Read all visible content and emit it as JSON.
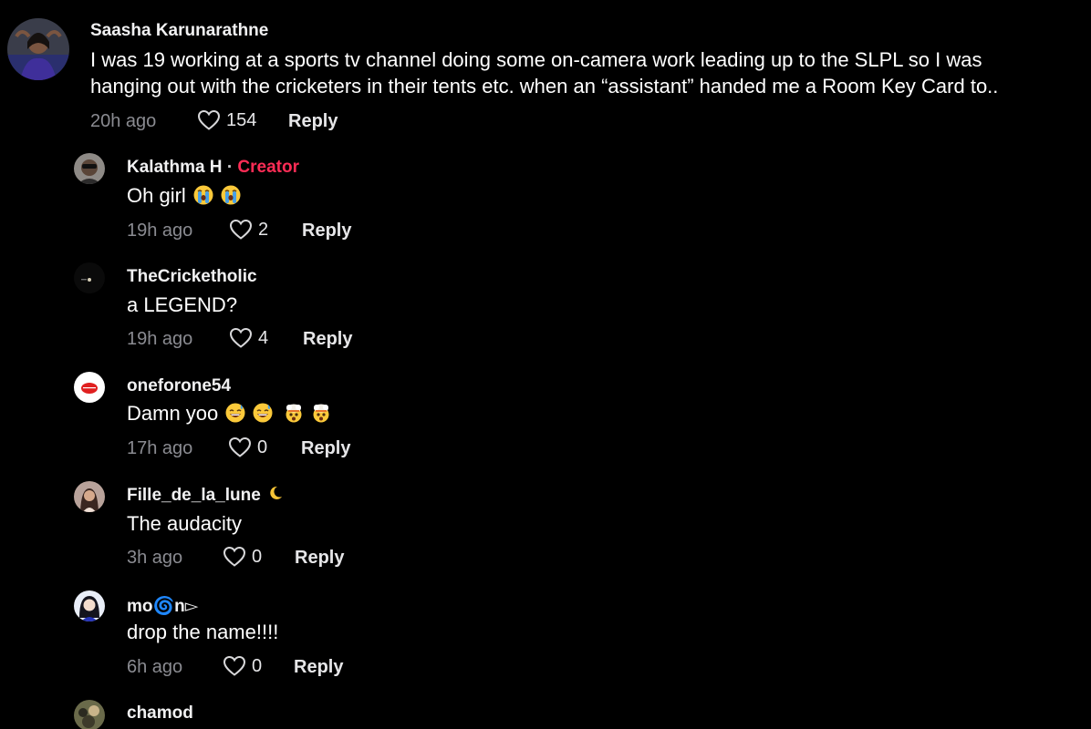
{
  "comments": [
    {
      "username": "Saasha Karunarathne",
      "text_line1": "I was 19 working at a sports tv channel doing some on-camera work leading up to the SLPL so I was",
      "text_line2": "hanging out with the cricketers in their tents etc. when an “assistant” handed me a Room Key Card to..",
      "time": "20h ago",
      "likes": "154",
      "reply_label": "Reply"
    },
    {
      "username": "Kalathma H",
      "separator": "·",
      "badge": "Creator",
      "text": "Oh girl",
      "emojis": [
        "loudly-crying-face",
        "loudly-crying-face"
      ],
      "time": "19h ago",
      "likes": "2",
      "reply_label": "Reply"
    },
    {
      "username": "TheCricketholic",
      "text": "a LEGEND?",
      "time": "19h ago",
      "likes": "4",
      "reply_label": "Reply"
    },
    {
      "username": "oneforone54",
      "text": "Damn yoo",
      "emojis": [
        "grinning-sweat-face",
        "grinning-sweat-face",
        "exploding-head",
        "exploding-head"
      ],
      "time": "17h ago",
      "likes": "0",
      "reply_label": "Reply"
    },
    {
      "username": "Fille_de_la_lune",
      "name_emoji": "crescent-moon",
      "text": "The audacity",
      "time": "3h ago",
      "likes": "0",
      "reply_label": "Reply"
    },
    {
      "username": "mo🌀n▻",
      "text": "drop the name!!!!",
      "time": "6h ago",
      "likes": "0",
      "reply_label": "Reply"
    },
    {
      "username": "chamod"
    }
  ],
  "colors": {
    "background": "#000000",
    "creator_badge": "#fe2c55",
    "meta_text": "#8a8b91"
  }
}
